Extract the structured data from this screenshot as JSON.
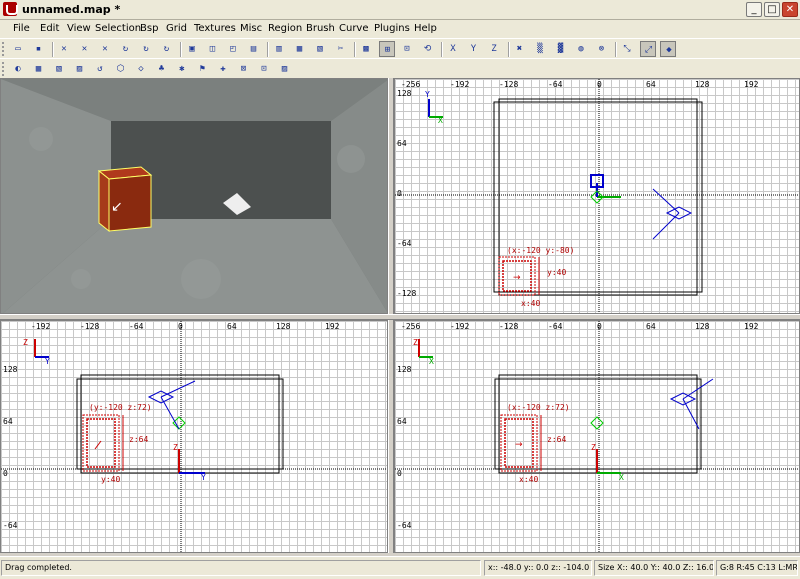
{
  "window": {
    "title": "unnamed.map *"
  },
  "menu": [
    "File",
    "Edit",
    "View",
    "Selection",
    "Bsp",
    "Grid",
    "Textures",
    "Misc",
    "Region",
    "Brush",
    "Curve",
    "Plugins",
    "Help"
  ],
  "toolbar1": {
    "icons": [
      "open-icon",
      "save-icon",
      "flip-x-icon",
      "flip-y-icon",
      "flip-z-icon",
      "rotate-x-icon",
      "rotate-y-icon",
      "rotate-z-icon",
      "select-complete-tall-icon",
      "select-touching-icon",
      "select-partial-tall-icon",
      "select-inside-icon",
      "csg-subtract-icon",
      "csg-merge-icon",
      "hollow-icon",
      "clipper-icon",
      "change-views-icon",
      "texture-view-icon",
      "cubic-clip-icon",
      "camera-move-icon",
      "view-xy-icon",
      "view-xz-icon",
      "view-yz-icon",
      "entity-icon",
      "filter-icon",
      "region-icon",
      "patch-icon",
      "lock-icon",
      "free-rotate-icon",
      "scale-icon",
      "patch-bend-icon"
    ],
    "glyphs": [
      "▭",
      "▪",
      "✕",
      "✕",
      "✕",
      "↻",
      "↻",
      "↻",
      "▣",
      "◫",
      "◰",
      "▤",
      "▥",
      "▦",
      "▧",
      "✂",
      "▩",
      "⊞",
      "⊡",
      "⟲",
      "X",
      "Y",
      "Z",
      "✖",
      "▒",
      "▓",
      "◍",
      "⊗",
      "⤡",
      "⤢",
      "◆"
    ]
  },
  "toolbar2": {
    "icons": [
      "texture-lock-icon",
      "patch-cap-icon",
      "patch-thicken-icon",
      "patch-matrix-icon",
      "patch-invert-icon",
      "patch-redisperse-icon",
      "patch-tesselate-icon",
      "dropper-icon",
      "bend-icon",
      "insert-icon",
      "weld-icon",
      "delete-icon",
      "clone-icon",
      "toggle-icon"
    ],
    "glyphs": [
      "◐",
      "▦",
      "▧",
      "▨",
      "↺",
      "⬡",
      "◇",
      "♣",
      "✱",
      "⚑",
      "✚",
      "⊠",
      "⊡",
      "▨"
    ]
  },
  "views": {
    "xy": {
      "ruler_x": [
        "-256",
        "-192",
        "-128",
        "-64",
        "0",
        "64",
        "128",
        "192"
      ],
      "ruler_y": [
        "128",
        "64",
        "0",
        "-64",
        "-128"
      ],
      "axis_v": "Y",
      "axis_h": "X",
      "labels": {
        "pos": "(x:-120  y:-80)",
        "w": "x:40",
        "h": "y:40"
      }
    },
    "yz": {
      "ruler_x": [
        "-192",
        "-128",
        "-64",
        "0",
        "64",
        "128",
        "192"
      ],
      "ruler_y": [
        "128",
        "64",
        "0",
        "-64"
      ],
      "axis_v": "Z",
      "axis_h": "Y",
      "labels": {
        "pos": "(y:-120  z:72)",
        "w": "y:40",
        "h": "z:64"
      }
    },
    "xz": {
      "ruler_x": [
        "-256",
        "-192",
        "-128",
        "-64",
        "0",
        "64",
        "128",
        "192"
      ],
      "ruler_y": [
        "128",
        "64",
        "0",
        "-64"
      ],
      "axis_v": "Z",
      "axis_h": "X",
      "labels": {
        "pos": "(x:-120  z:72)",
        "w": "x:40",
        "h": "z:64"
      }
    }
  },
  "status": {
    "message": "Drag completed.",
    "position": "x:: -48.0  y:: 0.0  z:: -104.0",
    "size": "Size X:: 40.0  Y:: 40.0  Z:: 16.0",
    "grid": "G:8 R:45 C:13 L:MR"
  }
}
